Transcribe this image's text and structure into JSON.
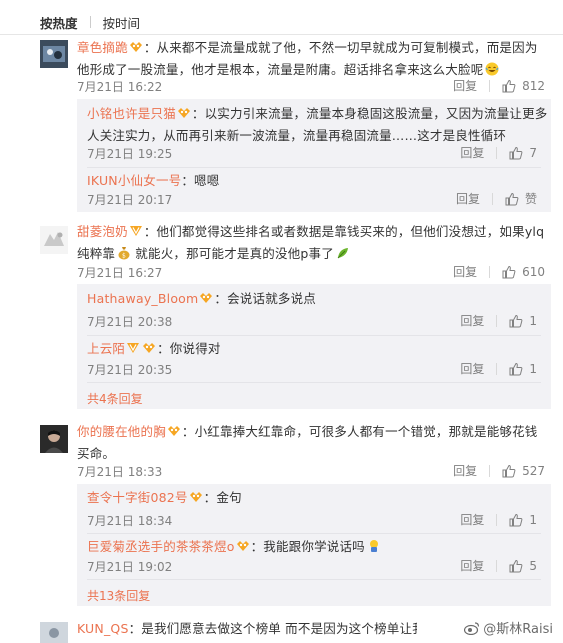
{
  "sort": {
    "hot": "按热度",
    "time": "按时间"
  },
  "reply_label": "回复",
  "like_praise_label": "赞",
  "comments": [
    {
      "user": "章色摘跪",
      "text": "：从来都不是流量成就了他，不然一切早就成为可复制模式，而是因为他形成了一股流量，他才是根本，流量是附庸。超话排名拿来这么大脸呢",
      "time": "7月21日 16:22",
      "likes": "812",
      "replies": [
        {
          "user": "小铭也许是只猫",
          "text": "：以实力引来流量，流量本身稳固这股流量，又因为流量让更多人关注实力，从而再引来新一波流量，流量再稳固流量……这才是良性循环",
          "time": "7月21日 19:25",
          "likes": "7"
        },
        {
          "user": "IKUN小仙女一号",
          "text": "：嗯嗯",
          "time": "7月21日 20:17",
          "likes": "赞"
        }
      ]
    },
    {
      "user": "甜菱泡奶",
      "text": "：他们都觉得这些排名或者数据是靠钱买来的，但他们没想过，如果ylq纯粹靠",
      "text2": "就能火，那可能才是真的没他p事了",
      "time": "7月21日 16:27",
      "likes": "610",
      "replies": [
        {
          "user": "Hathaway_Bloom",
          "text": "：会说话就多说点",
          "time": "7月21日 20:38",
          "likes": "1"
        },
        {
          "user": "上云陌",
          "text": "：你说得对",
          "time": "7月21日 20:35",
          "likes": "1"
        }
      ],
      "more": "共4条回复"
    },
    {
      "user": "你的腰在他的胸",
      "text": "：小红靠捧大红靠命，可很多人都有一个错觉，那就是能够花钱买命。",
      "time": "7月21日 18:33",
      "likes": "527",
      "replies": [
        {
          "user": "查令十字街082号",
          "text": "：金句",
          "time": "7月21日 18:34",
          "likes": "1"
        },
        {
          "user": "巨爱菊丞选手的茶茶茶煜o",
          "text": "：我能跟你学说话吗",
          "time": "7月21日 19:02",
          "likes": "5"
        }
      ],
      "more": "共13条回复"
    },
    {
      "user": "KUN_QS",
      "text": "：是我们愿意去做这个榜单  而不是因为这个榜单让我家变成"
    }
  ],
  "watermark": "@斯林Raisi",
  "colors": {
    "accent": "#eb7350",
    "meta": "#808080",
    "sub_bg": "#f2f2f5"
  }
}
